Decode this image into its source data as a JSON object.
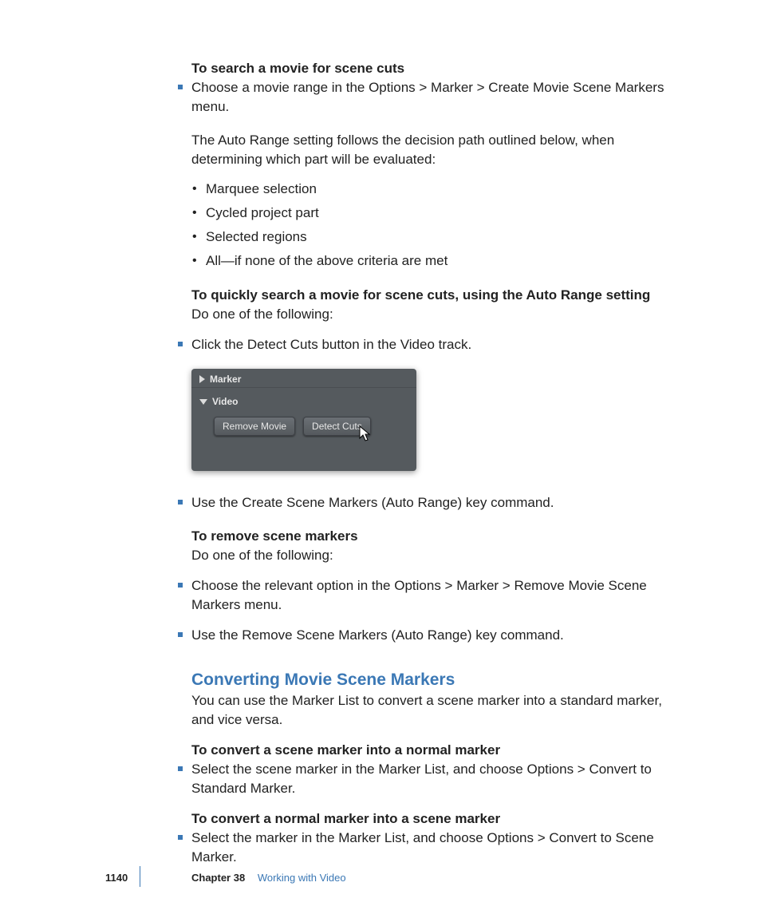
{
  "sections": {
    "search_heading": "To search a movie for scene cuts",
    "search_bullet": "Choose a movie range in the Options > Marker > Create Movie Scene Markers menu.",
    "auto_range_intro": "The Auto Range setting follows the decision path outlined below, when determining which part will be evaluated:",
    "auto_range_items": {
      "a": "Marquee selection",
      "b": "Cycled project part",
      "c": "Selected regions",
      "d": "All—if none of the above criteria are met"
    },
    "quick_search_heading": "To quickly search a movie for scene cuts, using the Auto Range setting",
    "do_one": "Do one of the following:",
    "detect_bullet": "Click the Detect Cuts button in the Video track.",
    "create_markers_bullet": "Use the Create Scene Markers (Auto Range) key command.",
    "remove_heading": "To remove scene markers",
    "remove_do_one": "Do one of the following:",
    "remove_option_bullet": "Choose the relevant option in the Options > Marker > Remove Movie Scene Markers menu.",
    "remove_cmd_bullet": "Use the Remove Scene Markers (Auto Range) key command.",
    "convert_title": "Converting Movie Scene Markers",
    "convert_intro": "You can use the Marker List to convert a scene marker into a standard marker, and vice versa.",
    "convert_to_normal_heading": "To convert a scene marker into a normal marker",
    "convert_to_normal_bullet": "Select the scene marker in the Marker List, and choose Options > Convert to Standard Marker.",
    "convert_to_scene_heading": "To convert a normal marker into a scene marker",
    "convert_to_scene_bullet": "Select the marker in the Marker List, and choose Options > Convert to Scene Marker."
  },
  "ui_panel": {
    "marker_label": "Marker",
    "video_label": "Video",
    "remove_btn": "Remove Movie",
    "detect_btn": "Detect Cuts"
  },
  "footer": {
    "page_number": "1140",
    "chapter_label": "Chapter 38",
    "chapter_title": "Working with Video"
  }
}
